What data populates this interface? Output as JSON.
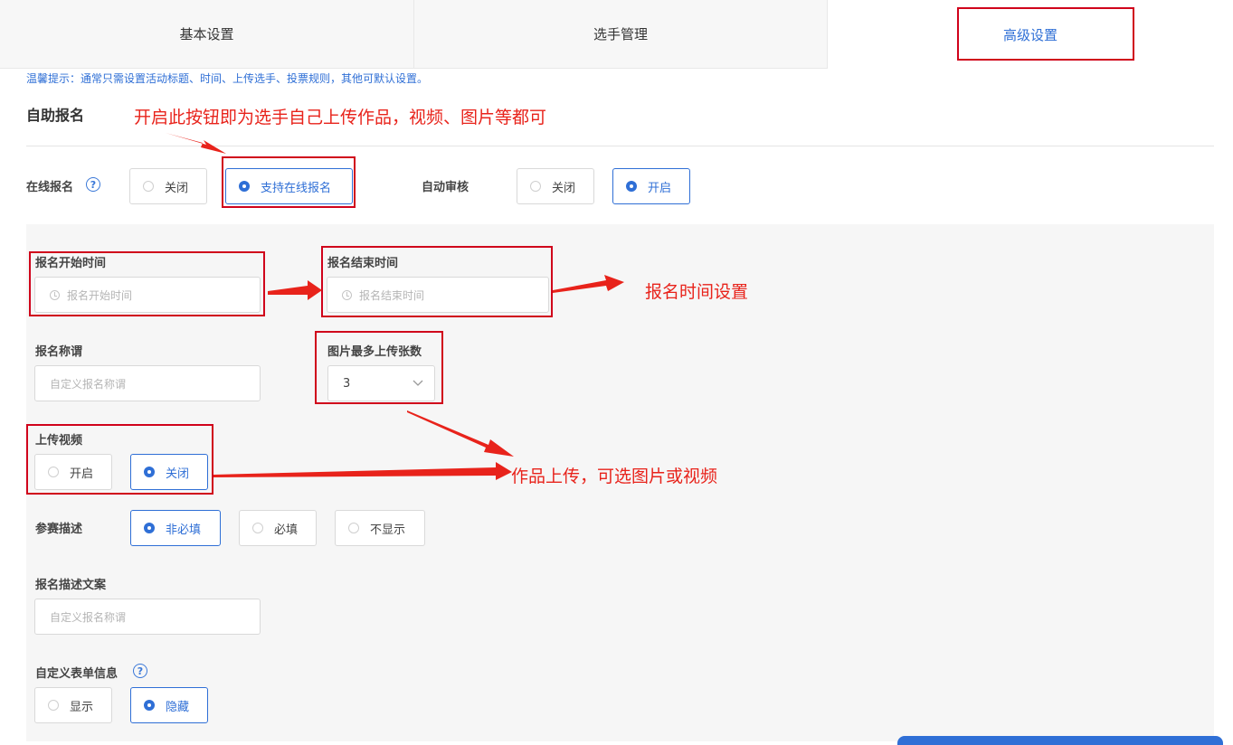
{
  "tabs": [
    {
      "label": "基本设置"
    },
    {
      "label": "选手管理"
    },
    {
      "label": "高级设置"
    }
  ],
  "tip": "温馨提示：通常只需设置活动标题、时间、上传选手、投票规则，其他可默认设置。",
  "section": {
    "title": "自助报名"
  },
  "online_signup": {
    "label": "在线报名",
    "options": [
      "关闭",
      "支持在线报名"
    ],
    "selected": "支持在线报名"
  },
  "auto_review": {
    "label": "自动审核",
    "options": [
      "关闭",
      "开启"
    ],
    "selected": "开启"
  },
  "signup_start": {
    "label": "报名开始时间",
    "placeholder": "报名开始时间"
  },
  "signup_end": {
    "label": "报名结束时间",
    "placeholder": "报名结束时间"
  },
  "signup_title": {
    "label": "报名称谓",
    "placeholder": "自定义报名称谓"
  },
  "max_images": {
    "label": "图片最多上传张数",
    "value": "3"
  },
  "upload_video": {
    "label": "上传视频",
    "options": [
      "开启",
      "关闭"
    ],
    "selected": "关闭"
  },
  "entry_desc": {
    "label": "参赛描述",
    "options": [
      "非必填",
      "必填",
      "不显示"
    ],
    "selected": "非必填"
  },
  "desc_copy": {
    "label": "报名描述文案",
    "placeholder": "自定义报名称谓"
  },
  "custom_form": {
    "label": "自定义表单信息",
    "options": [
      "显示",
      "隐藏"
    ],
    "selected": "隐藏"
  },
  "annotations": {
    "online": "开启此按钮即为选手自己上传作品，视频、图片等都可",
    "time": "报名时间设置",
    "upload": "作品上传，可选图片或视频"
  },
  "colors": {
    "accent": "#2f6fd6",
    "annotation": "#e8231b"
  },
  "icons": {
    "help": "question-circle-icon",
    "clock": "clock-icon",
    "chevron": "chevron-down-icon"
  }
}
